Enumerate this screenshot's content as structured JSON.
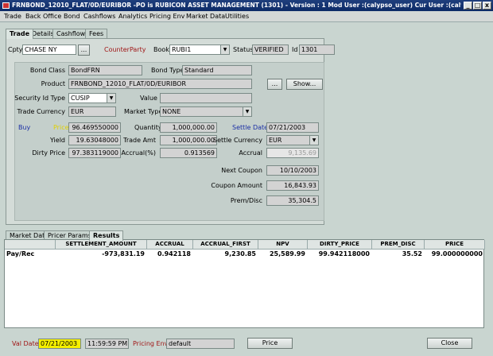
{
  "window": {
    "title": "FRNBOND_12010_FLAT/0D/EURIBOR  -PO is RUBICON ASSET MANAGEMENT  (1301) - Version : 1 Mod User :(calypso_user) Cur User :(calypso_user)  [62100/release/cal...",
    "min_symbol": "_",
    "max_symbol": "□",
    "close_symbol": "x"
  },
  "menu": [
    "Trade",
    "Back Office",
    "Bond",
    "Cashflows",
    "Analytics",
    "Pricing Env",
    "Market Data",
    "Utilities"
  ],
  "top_tabs": [
    "Trade",
    "Details",
    "Cashflows",
    "Fees"
  ],
  "trade": {
    "cpty_label": "Cpty",
    "cpty_value": "CHASE NY",
    "ellipsis": "...",
    "counterparty_label": "CounterParty",
    "book_label": "Book",
    "book_value": "RUBI1",
    "status_label": "Status",
    "status_value": "VERIFIED",
    "id_label": "Id",
    "id_value": "1301"
  },
  "bond": {
    "bond_class_label": "Bond Class",
    "bond_class_value": "BondFRN",
    "bond_type_label": "Bond Type",
    "bond_type_value": "Standard",
    "product_label": "Product",
    "product_value": "FRNBOND_12010_FLAT/0D/EURIBOR",
    "show_label": "Show...",
    "security_id_type_label": "Security Id Type",
    "security_id_type_value": "CUSIP",
    "value_label": "Value",
    "value_value": "",
    "trade_currency_label": "Trade Currency",
    "trade_currency_value": "EUR",
    "market_type_label": "Market Type",
    "market_type_value": "NONE"
  },
  "pricing": {
    "buy_label": "Buy",
    "price_label": "Price",
    "price_value": "96.469550000",
    "quantity_label": "Quantity",
    "quantity_value": "1,000,000.00",
    "settle_date_label": "Settle Date",
    "settle_date_value": "07/21/2003",
    "yield_label": "Yield",
    "yield_value": "19.63048000",
    "trade_amt_label": "Trade Amt",
    "trade_amt_value": "1,000,000.00",
    "settle_currency_label": "Settle Currency",
    "settle_currency_value": "EUR",
    "dirty_price_label": "Dirty Price",
    "dirty_price_value": "97.383119000",
    "accrual_pct_label": "Accrual(%)",
    "accrual_pct_value": "0.913569",
    "accrual_label": "Accrual",
    "accrual_value": "9,135.69",
    "next_coupon_label": "Next Coupon",
    "next_coupon_value": "10/10/2003",
    "coupon_amount_label": "Coupon Amount",
    "coupon_amount_value": "16,843.93",
    "prem_disc_label": "Prem/Disc",
    "prem_disc_value": "35,304.5"
  },
  "bottom_tabs": [
    "Market Data",
    "Pricer Params",
    "Results"
  ],
  "results": {
    "columns": [
      "",
      "SETTLEMENT_AMOUNT",
      "ACCRUAL",
      "ACCRUAL_FIRST",
      "NPV",
      "DIRTY_PRICE",
      "PREM_DISC",
      "PRICE"
    ],
    "rows": [
      [
        "Pay/Rec",
        "-973,831.19",
        "0.942118",
        "9,230.85",
        "25,589.99",
        "99.942118000",
        "35.52",
        "99.000000000"
      ]
    ]
  },
  "footer": {
    "val_date_label": "Val Date",
    "val_date_value": "07/21/2003",
    "val_time_value": "11:59:59 PM",
    "pricing_env_label": "Pricing Env",
    "pricing_env_value": "default",
    "price_button": "Price",
    "close_button": "Close"
  },
  "colors": {
    "title_bar": "#0c2a66",
    "background": "#c9d5d0",
    "red_label": "#a01616",
    "blue_label": "#1b2fa5",
    "yellow_field": "#f5ef00"
  }
}
